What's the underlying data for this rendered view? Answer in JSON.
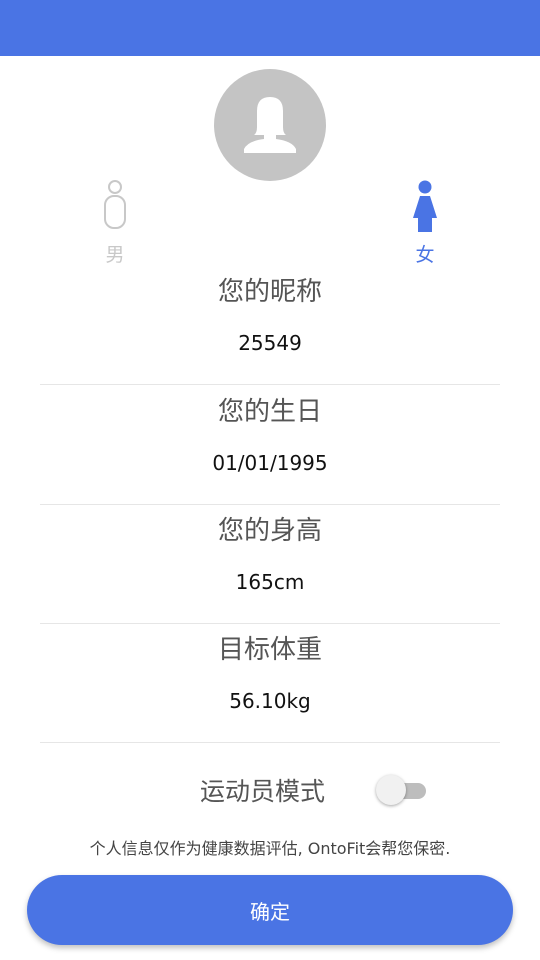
{
  "colors": {
    "accent": "#4a74e4",
    "avatar_bg": "#c4c4c4",
    "inactive": "#c8c8c8"
  },
  "avatar": {
    "icon": "female-avatar-icon"
  },
  "gender": {
    "male": {
      "label": "男",
      "icon": "male-person-icon",
      "selected": false
    },
    "female": {
      "label": "女",
      "icon": "female-person-icon",
      "selected": true
    }
  },
  "fields": {
    "nickname": {
      "label": "您的昵称",
      "value": "25549"
    },
    "birthday": {
      "label": "您的生日",
      "value": "01/01/1995"
    },
    "height": {
      "label": "您的身高",
      "value": "165cm"
    },
    "target_weight": {
      "label": "目标体重",
      "value": "56.10kg"
    }
  },
  "athlete_mode": {
    "label": "运动员模式",
    "enabled": false
  },
  "privacy_note": "个人信息仅作为健康数据评估, OntoFit会帮您保密.",
  "confirm_label": "确定"
}
